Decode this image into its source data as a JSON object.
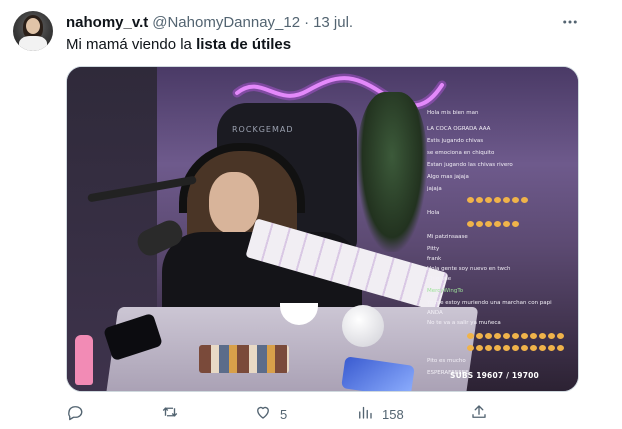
{
  "tweet": {
    "display_name": "nahomy_v.t",
    "handle": "@NahomyDannay_12",
    "separator": "·",
    "date": "13 jul.",
    "text_plain": "Mi mamá viendo la ",
    "text_bold": "lista de útiles"
  },
  "media": {
    "chair_brand": "ROCKGEMAD",
    "subs_label": "SUBS 19607 / 19700",
    "chat": [
      {
        "user": "",
        "msg": "Hola mis bien man"
      },
      {
        "user": "",
        "msg": "LA COCA OGRADA AAA"
      },
      {
        "user": "",
        "msg": "Estis jugando chivas"
      },
      {
        "user": "",
        "msg": "se emociona en chiquito"
      },
      {
        "user": "",
        "msg": "Estan jugando las chivas rivero"
      },
      {
        "user": "",
        "msg": "Algo mas jajaja"
      },
      {
        "user": "",
        "msg": "jajaja"
      },
      {
        "user": "",
        "msg": "Hola"
      },
      {
        "user": "",
        "msg": "Mi patzinsaase"
      },
      {
        "user": "",
        "msg": "Pitty"
      },
      {
        "user": "",
        "msg": "frank"
      },
      {
        "user": "",
        "msg": "Hola gente soy nuevo en twch"
      },
      {
        "user": "",
        "msg": "Chiqhale"
      },
      {
        "user": "MercyWingTo",
        "msg": ""
      },
      {
        "user": "",
        "msg": "Yo me estoy muriendo una marchan con papi"
      },
      {
        "user": "",
        "msg": "ANDA"
      },
      {
        "user": "",
        "msg": "No te va a salir ya muñeca"
      },
      {
        "user": "",
        "msg": "Pito es mucho"
      },
      {
        "user": "",
        "msg": "ESPERAFEEEEE"
      }
    ]
  },
  "actions": {
    "reply_count": "",
    "retweet_count": "",
    "like_count": "5",
    "view_count": "158"
  },
  "colors": {
    "text_primary": "#0f1419",
    "text_secondary": "#536471",
    "border": "#cfd9de",
    "chat_username": "#9ee29a"
  }
}
